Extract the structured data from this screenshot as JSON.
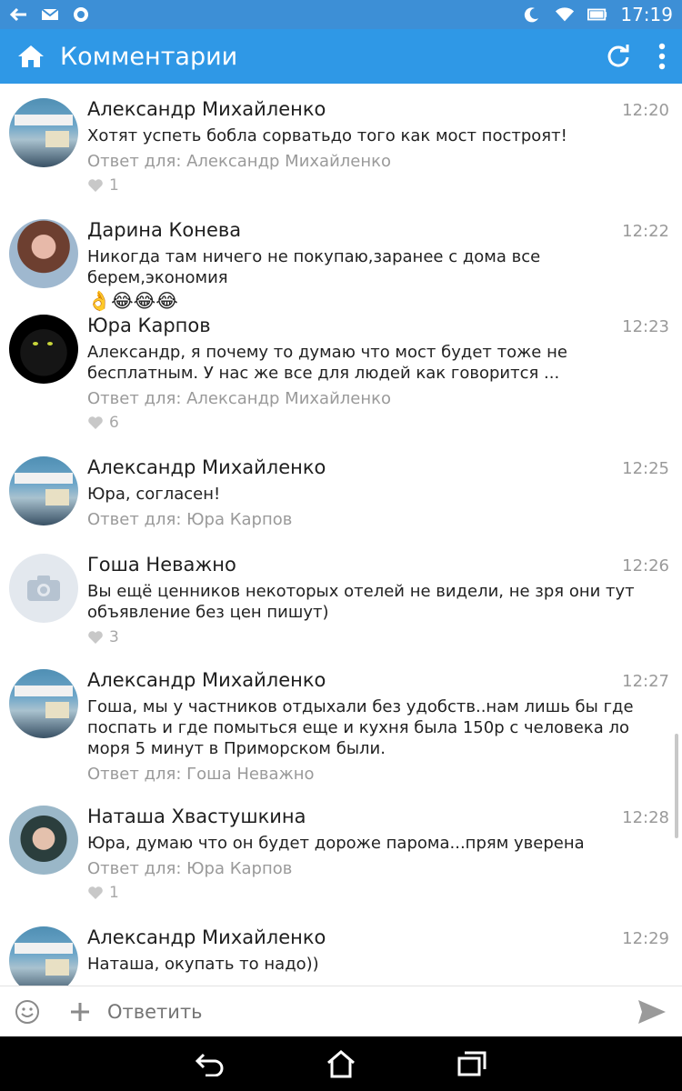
{
  "status_bar": {
    "time": "17:19"
  },
  "app_bar": {
    "title": "Комментарии"
  },
  "comments": [
    {
      "name": "Александр Михайленко",
      "time": "12:20",
      "text": "Хотят успеть бобла сорватьдо того как мост построят!",
      "reply_to": "Ответ для: Александр Михайленко",
      "likes": "1",
      "avatar": "poster"
    },
    {
      "name": "Дарина Конева",
      "time": "12:22",
      "text": "Никогда там ничего не покупаю,заранее с дома все берем,экономия",
      "emoji": "👌😂😂😂",
      "avatar": "woman"
    },
    {
      "name": "Юра Карпов",
      "time": "12:23",
      "text": "Александр, я почему то думаю что мост будет тоже не бесплатным. У нас же все для людей как говорится ...",
      "reply_to": "Ответ для: Александр Михайленко",
      "likes": "6",
      "avatar": "cat"
    },
    {
      "name": "Александр Михайленко",
      "time": "12:25",
      "text": "Юра, согласен!",
      "reply_to": "Ответ для: Юра Карпов",
      "avatar": "poster"
    },
    {
      "name": "Гоша Неважно",
      "time": "12:26",
      "text": "Вы ещё ценников некоторых отелей не видели, не зря они тут объявление без цен пишут)",
      "likes": "3",
      "avatar": "default"
    },
    {
      "name": "Александр Михайленко",
      "time": "12:27",
      "text": "Гоша, мы у частников отдыхали без удобств..нам лишь бы где поспать и где помыться еще и кухня была 150р с человека ло моря 5 минут в Приморском были.",
      "reply_to": "Ответ для: Гоша Неважно",
      "avatar": "poster"
    },
    {
      "name": "Наташа Хвастушкина",
      "time": "12:28",
      "text": "Юра, думаю что он будет дороже парома...прям уверена",
      "reply_to": "Ответ для: Юра Карпов",
      "likes": "1",
      "avatar": "natasha"
    },
    {
      "name": "Александр Михайленко",
      "time": "12:29",
      "text": "Наташа, окупать то надо))",
      "avatar": "poster"
    }
  ],
  "reply_bar": {
    "placeholder": "Ответить"
  },
  "colors": {
    "app_bar": "#2f98e6",
    "status_bar": "#3d8fd6",
    "muted": "#9a9a9a"
  }
}
